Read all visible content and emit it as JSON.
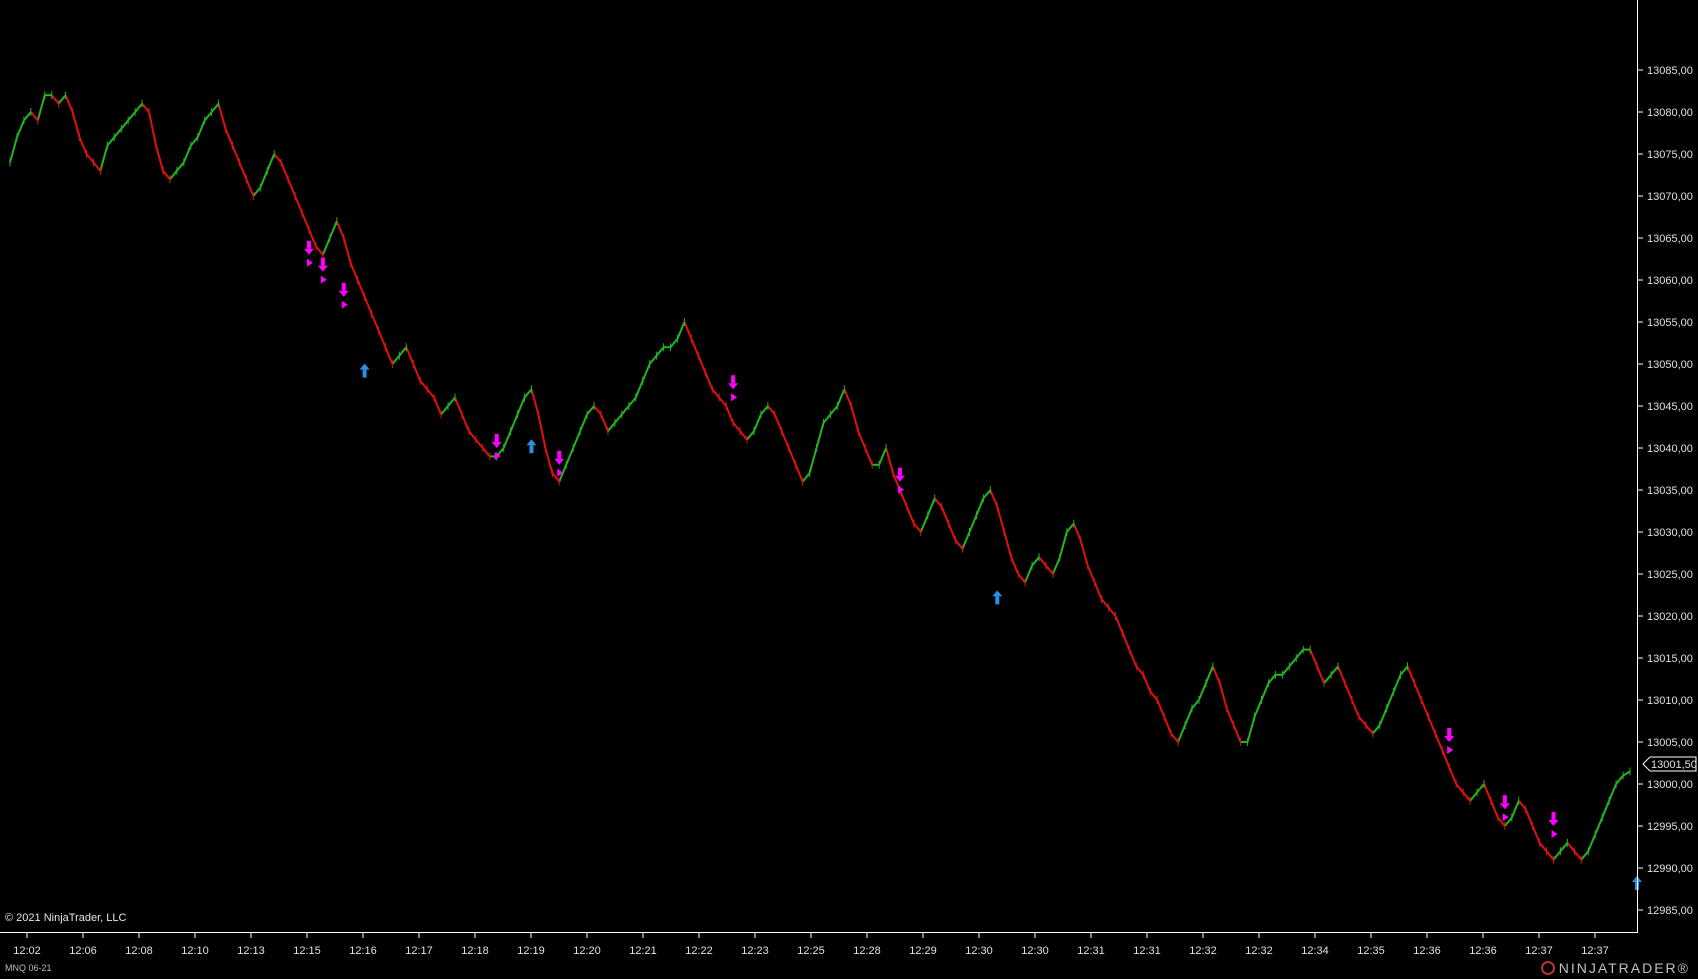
{
  "instrument": "MNQ 06-21",
  "copyright": "© 2021 NinjaTrader, LLC",
  "brand": "NINJATRADER®",
  "last_price_label": "13001,50",
  "colors": {
    "up": "#22b522",
    "down": "#e01010",
    "sell_marker": "#ff00ff",
    "buy_marker": "#2b8fe8",
    "axis": "#ffffff",
    "background": "#000000"
  },
  "chart_data": {
    "type": "line",
    "ylim": [
      12983,
      13089
    ],
    "yticks": [
      "12985,00",
      "12990,00",
      "12995,00",
      "13000,00",
      "13005,00",
      "13010,00",
      "13015,00",
      "13020,00",
      "13025,00",
      "13030,00",
      "13035,00",
      "13040,00",
      "13045,00",
      "13050,00",
      "13055,00",
      "13060,00",
      "13065,00",
      "13070,00",
      "13075,00",
      "13080,00",
      "13085,00"
    ],
    "ytick_values": [
      12985,
      12990,
      12995,
      13000,
      13005,
      13010,
      13015,
      13020,
      13025,
      13030,
      13035,
      13040,
      13045,
      13050,
      13055,
      13060,
      13065,
      13070,
      13075,
      13080,
      13085
    ],
    "xticks": [
      "12:02",
      "12:06",
      "12:08",
      "12:10",
      "12:13",
      "12:15",
      "12:16",
      "12:17",
      "12:18",
      "12:19",
      "12:20",
      "12:21",
      "12:22",
      "12:23",
      "12:25",
      "12:28",
      "12:29",
      "12:30",
      "12:30",
      "12:31",
      "12:31",
      "12:32",
      "12:32",
      "12:34",
      "12:35",
      "12:36",
      "12:36",
      "12:37",
      "12:37"
    ],
    "series": [
      {
        "values": [
          13074,
          13077,
          13079,
          13080,
          13079,
          13082,
          13082,
          13081,
          13082,
          13080,
          13077,
          13075,
          13074,
          13073,
          13076,
          13077,
          13078,
          13079,
          13080,
          13081,
          13080,
          13076,
          13073,
          13072,
          13073,
          13074,
          13076,
          13077,
          13079,
          13080,
          13081,
          13078,
          13076,
          13074,
          13072,
          13070,
          13071,
          13073,
          13075,
          13074,
          13072,
          13070,
          13068,
          13066,
          13064,
          13063,
          13065,
          13067,
          13065,
          13062,
          13060,
          13058,
          13056,
          13054,
          13052,
          13050,
          13051,
          13052,
          13050,
          13048,
          13047,
          13046,
          13044,
          13045,
          13046,
          13044,
          13042,
          13041,
          13040,
          13039,
          13039,
          13040,
          13042,
          13044,
          13046,
          13047,
          13044,
          13040,
          13037,
          13036,
          13038,
          13040,
          13042,
          13044,
          13045,
          13044,
          13042,
          13043,
          13044,
          13045,
          13046,
          13048,
          13050,
          13051,
          13052,
          13052,
          13053,
          13055,
          13053,
          13051,
          13049,
          13047,
          13046,
          13045,
          13043,
          13042,
          13041,
          13042,
          13044,
          13045,
          13044,
          13042,
          13040,
          13038,
          13036,
          13037,
          13040,
          13043,
          13044,
          13045,
          13047,
          13045,
          13042,
          13040,
          13038,
          13038,
          13040,
          13037,
          13035,
          13033,
          13031,
          13030,
          13032,
          13034,
          13033,
          13031,
          13029,
          13028,
          13030,
          13032,
          13034,
          13035,
          13033,
          13030,
          13027,
          13025,
          13024,
          13026,
          13027,
          13026,
          13025,
          13027,
          13030,
          13031,
          13029,
          13026,
          13024,
          13022,
          13021,
          13020,
          13018,
          13016,
          13014,
          13013,
          13011,
          13010,
          13008,
          13006,
          13005,
          13007,
          13009,
          13010,
          13012,
          13014,
          13012,
          13009,
          13007,
          13005,
          13005,
          13008,
          13010,
          13012,
          13013,
          13013,
          13014,
          13015,
          13016,
          13016,
          13014,
          13012,
          13013,
          13014,
          13012,
          13010,
          13008,
          13007,
          13006,
          13007,
          13009,
          13011,
          13013,
          13014,
          13012,
          13010,
          13008,
          13006,
          13004,
          13002,
          13000,
          12999,
          12998,
          12999,
          13000,
          12998,
          12996,
          12995,
          12996,
          12998,
          12997,
          12995,
          12993,
          12992,
          12991,
          12992,
          12993,
          12992,
          12991,
          12992,
          12994,
          12996,
          12998,
          13000,
          13001,
          13001.5
        ]
      }
    ],
    "markers_sell": [
      {
        "i": 43,
        "y": 13063
      },
      {
        "i": 45,
        "y": 13061
      },
      {
        "i": 48,
        "y": 13058
      },
      {
        "i": 70,
        "y": 13040
      },
      {
        "i": 79,
        "y": 13038
      },
      {
        "i": 104,
        "y": 13047
      },
      {
        "i": 128,
        "y": 13036
      },
      {
        "i": 207,
        "y": 13005
      },
      {
        "i": 215,
        "y": 12997
      },
      {
        "i": 222,
        "y": 12995
      }
    ],
    "markers_buy": [
      {
        "i": 51,
        "y": 13051
      },
      {
        "i": 75,
        "y": 13042
      },
      {
        "i": 142,
        "y": 13024
      },
      {
        "i": 234,
        "y": 12990
      }
    ]
  }
}
